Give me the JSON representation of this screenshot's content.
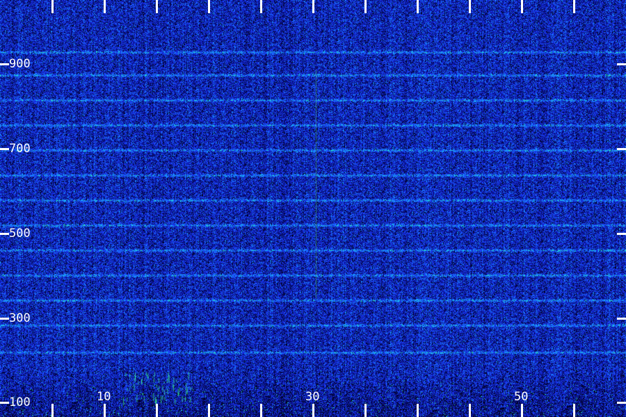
{
  "image": {
    "kind": "spectrogram",
    "colormap": [
      "#000018",
      "#0a14a0",
      "#1e3cff",
      "#14b4ff",
      "#3cff8c"
    ]
  },
  "y_axis": {
    "labels": [
      "900",
      "700",
      "500",
      "300",
      "100"
    ]
  },
  "x_axis": {
    "labels": [
      "10",
      "30",
      "50"
    ]
  }
}
